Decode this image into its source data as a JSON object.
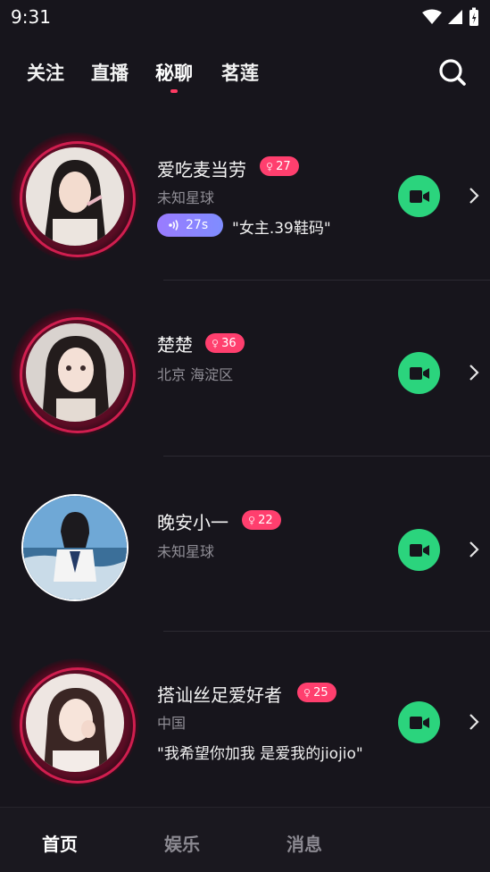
{
  "status_bar": {
    "time": "9:31"
  },
  "top_nav": {
    "tabs": [
      {
        "label": "关注"
      },
      {
        "label": "直播"
      },
      {
        "label": "秘聊",
        "active": true
      },
      {
        "label": "茗莲"
      }
    ]
  },
  "users": [
    {
      "name": "爱吃麦当劳",
      "badge": "27",
      "location": "未知星球",
      "voice_duration": "27s",
      "quote": "\"女主.39鞋码\"",
      "ring": true
    },
    {
      "name": "楚楚",
      "badge": "36",
      "location": "北京 海淀区",
      "ring": true
    },
    {
      "name": "晚安小一",
      "badge": "22",
      "location": "未知星球",
      "ring": false
    },
    {
      "name": "搭讪丝足爱好者",
      "badge": "25",
      "location": "中国",
      "quote": "\"我希望你加我 是爱我的jiojio\"",
      "ring": true
    }
  ],
  "bottom_nav": {
    "items": [
      {
        "label": "首页",
        "active": true
      },
      {
        "label": "娱乐"
      },
      {
        "label": "消息"
      }
    ]
  },
  "colors": {
    "accent": "#ff3f6e",
    "video_button": "#2bd47d",
    "background": "#17151c",
    "ring": "#d01e4f"
  },
  "icons": {
    "search": "search-icon",
    "video": "video-camera-icon",
    "chevron": "chevron-right-icon",
    "voice": "voice-wave-icon",
    "badge": "female-symbol-icon"
  }
}
